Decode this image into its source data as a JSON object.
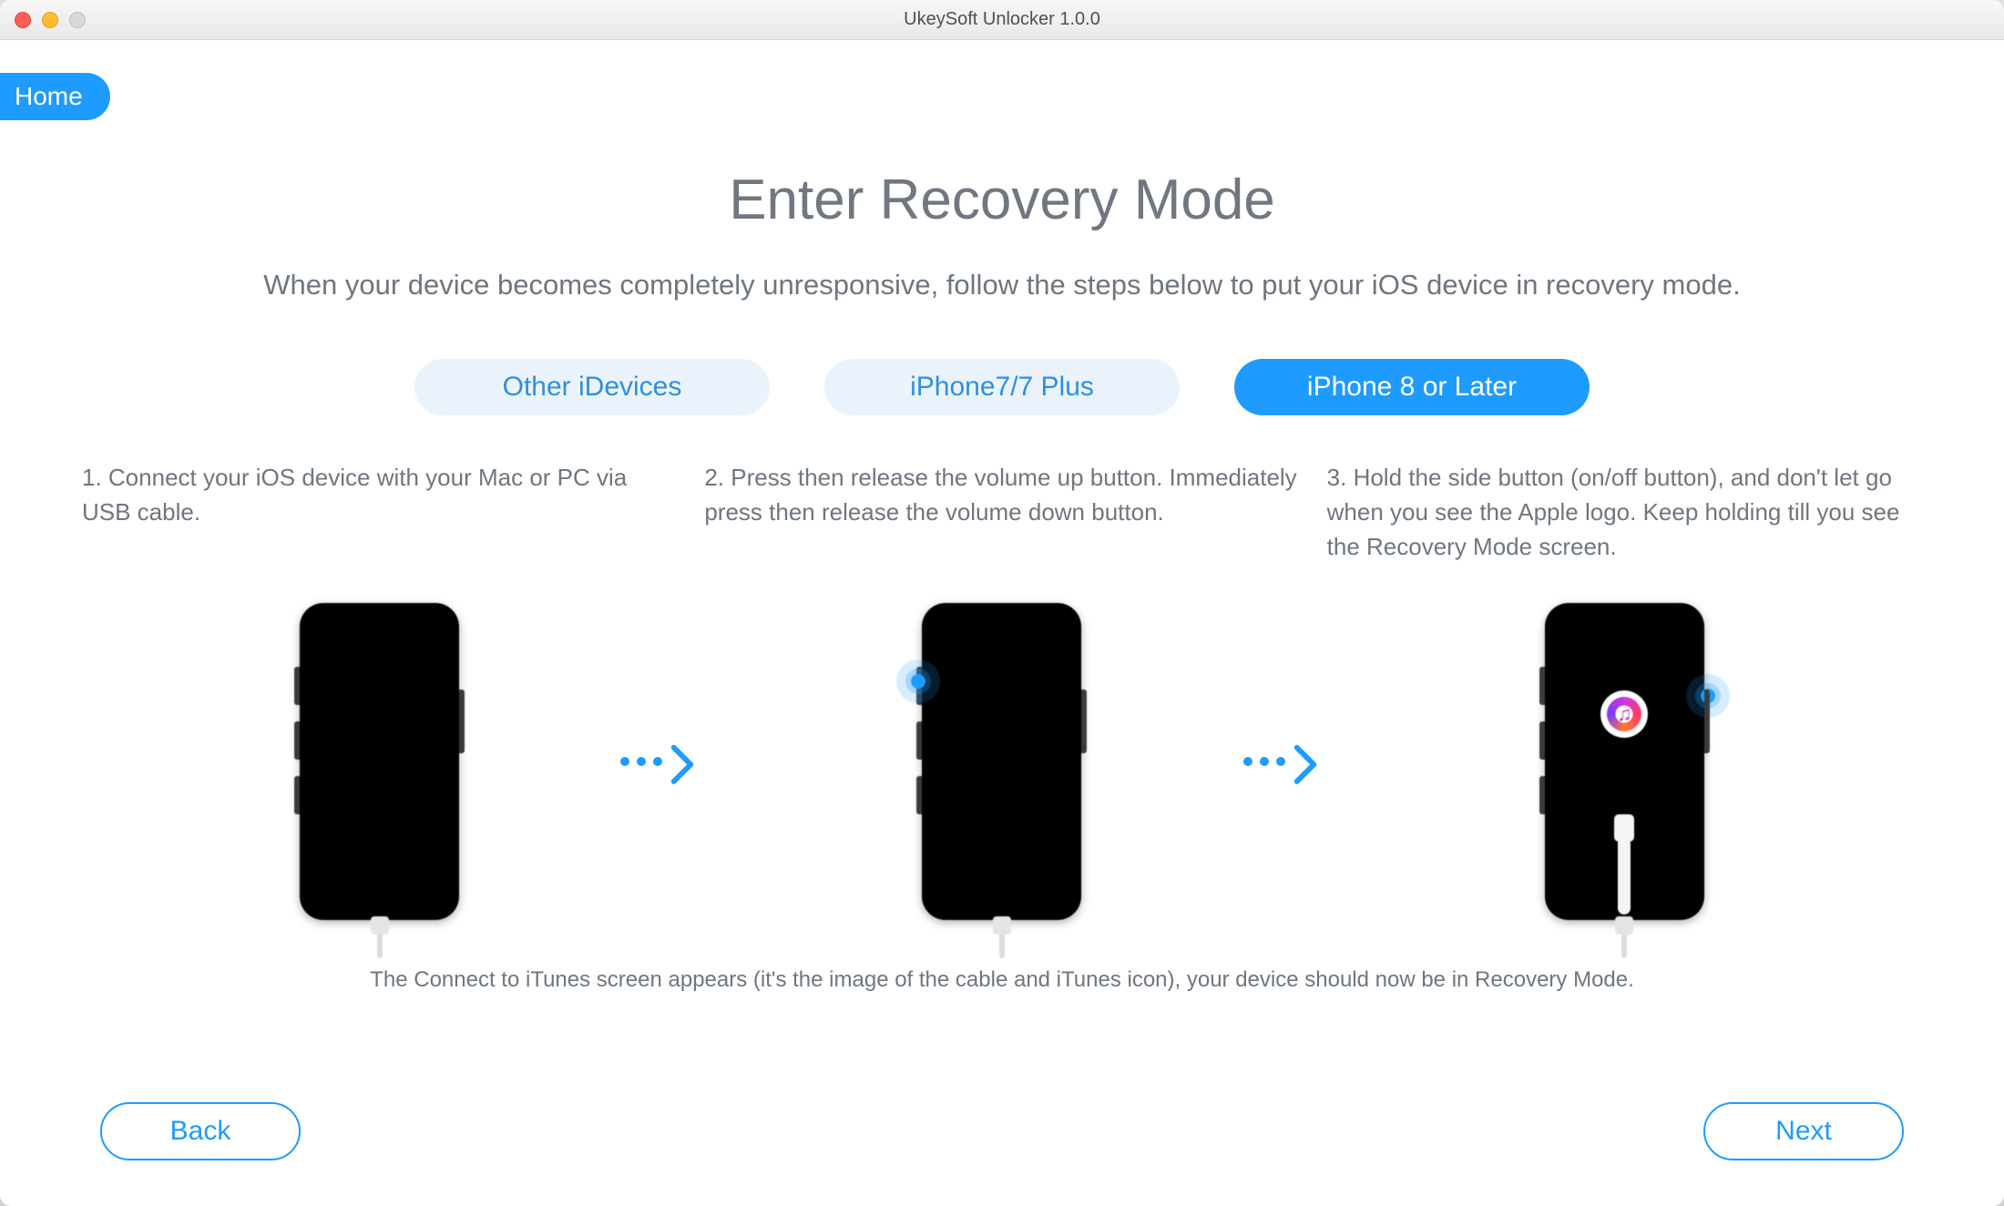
{
  "window": {
    "title": "UkeySoft Unlocker 1.0.0"
  },
  "home_tab": "Home",
  "page": {
    "title": "Enter Recovery Mode",
    "subtitle": "When your device becomes completely unresponsive, follow the steps below to put your iOS device in recovery mode."
  },
  "tabs": [
    {
      "label": "Other iDevices",
      "active": false
    },
    {
      "label": "iPhone7/7 Plus",
      "active": false
    },
    {
      "label": "iPhone 8 or Later",
      "active": true
    }
  ],
  "steps": [
    {
      "text": "1. Connect your iOS device with your Mac or PC via USB cable."
    },
    {
      "text": "2. Press then release the volume up button. Immediately press then release the volume down button."
    },
    {
      "text": "3. Hold the side button (on/off button), and don't let go when you see the Apple logo. Keep holding till you see the Recovery Mode screen."
    }
  ],
  "footnote": "The Connect to iTunes screen appears (it's the image of the cable and iTunes icon), your device should now be in Recovery Mode.",
  "buttons": {
    "back": "Back",
    "next": "Next"
  }
}
